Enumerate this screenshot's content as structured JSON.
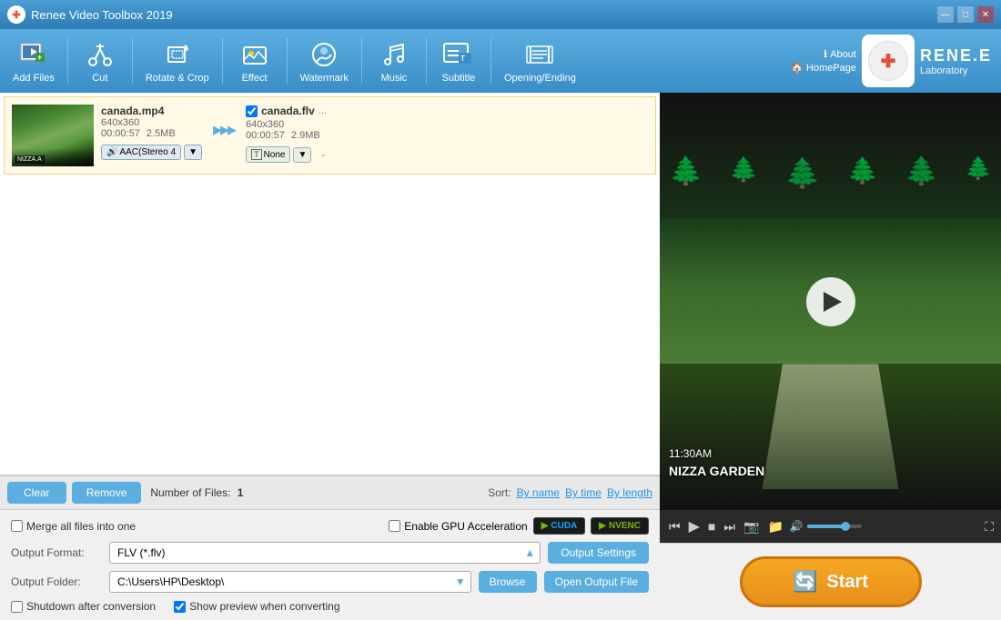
{
  "titleBar": {
    "title": "Renee Video Toolbox 2019",
    "logo": "✚",
    "windowControls": {
      "minimize": "—",
      "maximize": "□",
      "close": "✕"
    }
  },
  "toolbar": {
    "items": [
      {
        "id": "add-files",
        "label": "Add Files",
        "icon": "🎬"
      },
      {
        "id": "cut",
        "label": "Cut",
        "icon": "✂"
      },
      {
        "id": "rotate-crop",
        "label": "Rotate & Crop",
        "icon": "⬜"
      },
      {
        "id": "effect",
        "label": "Effect",
        "icon": "✨"
      },
      {
        "id": "watermark",
        "label": "Watermark",
        "icon": "💧"
      },
      {
        "id": "music",
        "label": "Music",
        "icon": "♪"
      },
      {
        "id": "subtitle",
        "label": "Subtitle",
        "icon": "SUB"
      },
      {
        "id": "opening-ending",
        "label": "Opening/Ending",
        "icon": "▬"
      }
    ],
    "about": "About",
    "homepage": "HomePage",
    "brandName": "RENE.E",
    "brandSub": "Laboratory"
  },
  "fileList": {
    "items": [
      {
        "inputName": "canada.mp4",
        "inputResolution": "640x360",
        "inputDuration": "00:00:57",
        "inputSize": "2.5MB",
        "outputName": "canada.flv",
        "outputResolution": "640x360",
        "outputDuration": "00:00:57",
        "outputSize": "2.9MB",
        "audioTrack": "AAC(Stereo 4",
        "subtitle": "None",
        "thumbLabel": "NIZZA.A"
      }
    ],
    "arrowSymbol": "▶▶▶",
    "moreSymbol": "...",
    "dashSymbol": "-"
  },
  "listControls": {
    "clearBtn": "Clear",
    "removeBtn": "Remove",
    "fileCountLabel": "Number of Files:",
    "fileCountValue": "1",
    "sortLabel": "Sort:",
    "sortByName": "By name",
    "sortByTime": "By time",
    "sortByLength": "By length"
  },
  "settings": {
    "mergeLabel": "Merge all files into one",
    "enableGpuLabel": "Enable GPU Acceleration",
    "cudaLabel": "CUDA",
    "nvencLabel": "NVENC",
    "outputFormatLabel": "Output Format:",
    "outputFormatValue": "FLV (*.flv)",
    "outputSettingsBtn": "Output Settings",
    "outputFolderLabel": "Output Folder:",
    "outputFolderValue": "C:\\Users\\HP\\Desktop\\",
    "browseBtn": "Browse",
    "openOutputBtn": "Open Output File",
    "shutdownLabel": "Shutdown after conversion",
    "showPreviewLabel": "Show preview when converting",
    "startBtn": "Start",
    "mergeChecked": false,
    "enableGpuChecked": false,
    "shutdownChecked": false,
    "showPreviewChecked": true
  },
  "videoPreview": {
    "overlayTime": "11:30AM",
    "overlayName": "NIZZA GARDEN",
    "playBtn": "▶"
  }
}
